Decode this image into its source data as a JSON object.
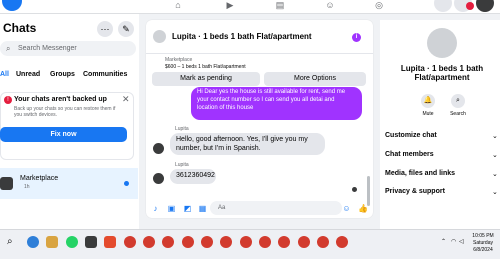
{
  "chats_panel": {
    "title": "Chats",
    "more_icon": "ellipsis-icon",
    "compose_icon": "compose-icon",
    "search_placeholder": "Search Messenger",
    "filters": [
      "All",
      "Unread",
      "Groups",
      "Communities"
    ],
    "active_filter": "All",
    "backup": {
      "title": "Your chats aren't backed up",
      "body": "Back up your chats so you can restore them if you switch devices.",
      "button": "Fix now"
    },
    "conversations": [
      {
        "name": "Marketplace",
        "time": "1h"
      }
    ]
  },
  "chat": {
    "title": "Lupita · 1 beds 1 bath Flat/apartment",
    "listing_label": "Marketplace",
    "listing_detail": "$600 – 1 beds 1 bath Flat/apartment",
    "mark_pending": "Mark as pending",
    "more_options": "More Options",
    "messages": [
      {
        "direction": "out",
        "text": "Hi Dear yes the house is still available for rent, send me your contact number so I can send you all detai and location of this house"
      },
      {
        "direction": "in",
        "sender": "Lupita",
        "text": "Hello, good afternoon. Yes, I'll give you my number, but I'm in Spanish."
      },
      {
        "direction": "in",
        "sender": "Lupita",
        "text": "3612360492"
      }
    ],
    "composer_placeholder": "Aa"
  },
  "details_panel": {
    "name": "Lupita · 1 beds 1 bath Flat/apartment",
    "actions": [
      "Mute",
      "Search"
    ],
    "sections": [
      "Customize chat",
      "Chat members",
      "Media, files and links",
      "Privacy & support"
    ]
  },
  "taskbar": {
    "time": "10:05 PM",
    "day": "Saturday",
    "date": "6/8/2024"
  },
  "colors": {
    "accent": "#1877f2",
    "outgoing_bubble": "#a033ff",
    "alert": "#e41e3f"
  }
}
